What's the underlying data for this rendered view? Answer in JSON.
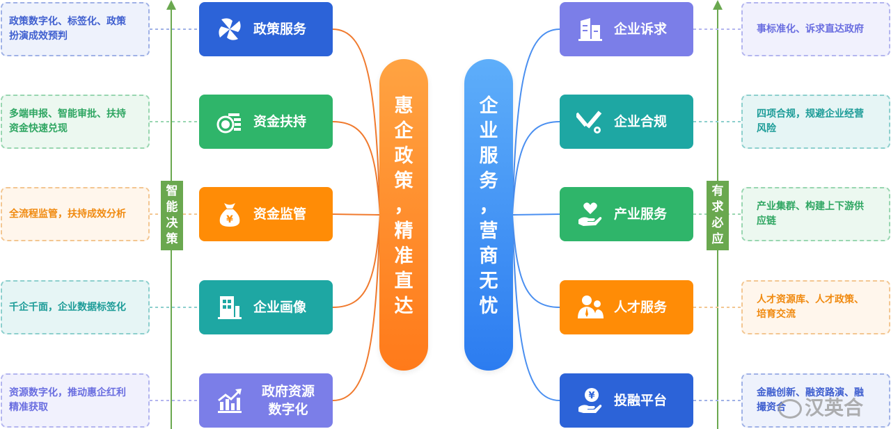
{
  "left": {
    "axis_tag": "智能决策",
    "center_title": [
      "惠",
      "企",
      "政",
      "策",
      "，",
      "精",
      "准",
      "直",
      "达"
    ],
    "nodes": [
      {
        "label": "政策服务",
        "icon": "pinwheel-icon",
        "color": "#2c63d8",
        "desc": [
          "政策数字化、标签化、政策",
          "扮演成效预判"
        ],
        "desc_color": "#3f5fcf",
        "desc_bg": "#eef2fc",
        "desc_border": "#9fb1e6"
      },
      {
        "label": "资金扶持",
        "icon": "coin-stack-icon",
        "color": "#2fb56a",
        "desc": [
          "多端申报、智能审批、扶持",
          "资金快速兑现"
        ],
        "desc_color": "#2fa662",
        "desc_bg": "#ecf8f0",
        "desc_border": "#98d6b0"
      },
      {
        "label": "资金监管",
        "icon": "money-bag-icon",
        "color": "#ff8c06",
        "desc": [
          "全流程监管，扶持成效分析"
        ],
        "desc_color": "#f08a10",
        "desc_bg": "#fff6ec",
        "desc_border": "#f3c691"
      },
      {
        "label": "企业画像",
        "icon": "building-icon",
        "color": "#1ea7a3",
        "desc": [
          "千企千面，企业数据标签化"
        ],
        "desc_color": "#1d9c98",
        "desc_bg": "#e6f5f5",
        "desc_border": "#8ccfcd"
      },
      {
        "label": "政府资源\n数字化",
        "label_lines": [
          "政府资源",
          "数字化"
        ],
        "icon": "growth-chart-icon",
        "color": "#7b7ee8",
        "desc": [
          "资源数字化，推动惠企红利",
          "精准获取"
        ],
        "desc_color": "#6a6ee0",
        "desc_bg": "#f1f1fd",
        "desc_border": "#b3b5ef"
      }
    ]
  },
  "right": {
    "axis_tag": "有求必应",
    "center_title": [
      "企",
      "业",
      "服",
      "务",
      "，",
      "营",
      "商",
      "无",
      "忧"
    ],
    "nodes": [
      {
        "label": "企业诉求",
        "icon": "office-buildings-icon",
        "color": "#7b7ee8",
        "desc": [
          "事标准化、诉求直达政府"
        ],
        "desc_color": "#6a6ee0",
        "desc_bg": "#f1f1fd",
        "desc_border": "#b3b5ef"
      },
      {
        "label": "企业合规",
        "icon": "pencil-ruler-gear-icon",
        "color": "#1ea7a3",
        "desc": [
          "四项合规，规避企业经营",
          "风险"
        ],
        "desc_color": "#1d9c98",
        "desc_bg": "#e6f5f5",
        "desc_border": "#8ccfcd"
      },
      {
        "label": "产业服务",
        "icon": "heart-hand-icon",
        "color": "#2fb56a",
        "desc": [
          "产业集群、构建上下游供",
          "应链"
        ],
        "desc_color": "#2fa662",
        "desc_bg": "#ecf8f0",
        "desc_border": "#98d6b0"
      },
      {
        "label": "人才服务",
        "icon": "people-icon",
        "color": "#ff8c06",
        "desc": [
          "人才资源库、人才政策、",
          "培育交流"
        ],
        "desc_color": "#f08a10",
        "desc_bg": "#fff6ec",
        "desc_border": "#f3c691"
      },
      {
        "label": "投融平台",
        "icon": "yuan-hand-icon",
        "color": "#2c63d8",
        "desc": [
          "金融创新、融资路演、融",
          "撮资合"
        ],
        "desc_color": "#3f5fcf",
        "desc_bg": "#eef2fc",
        "desc_border": "#9fb1e6"
      }
    ]
  },
  "watermark": "汉英合",
  "colors": {
    "left_pill_top": "#ffa040",
    "left_pill_bottom": "#ff7a1a",
    "right_pill_top": "#5aaaf8",
    "right_pill_bottom": "#2f7ef0",
    "left_connector": "#f07a2e",
    "right_connector": "#4a8ff0",
    "axis": "#6aa84f"
  }
}
